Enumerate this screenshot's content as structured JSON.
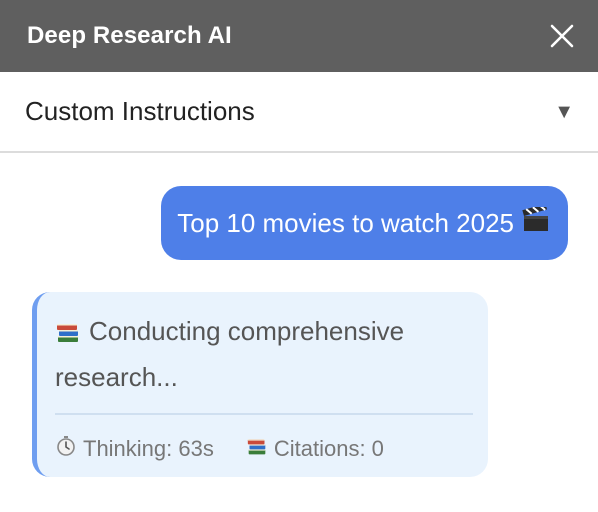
{
  "header": {
    "title": "Deep Research AI",
    "close_icon": "close-icon"
  },
  "instructions": {
    "label": "Custom Instructions",
    "arrow": "▼"
  },
  "chat": {
    "user_message": "Top 10 movies to watch 2025",
    "ai_status": "Conducting comprehensive research...",
    "thinking": "Thinking: 63s",
    "citations": "Citations: 0"
  },
  "colors": {
    "header_bg": "#5f5f5f",
    "user_bubble": "#4e7fe8",
    "ai_bubble": "#e9f3fd",
    "ai_accent": "#6f9ef0"
  }
}
